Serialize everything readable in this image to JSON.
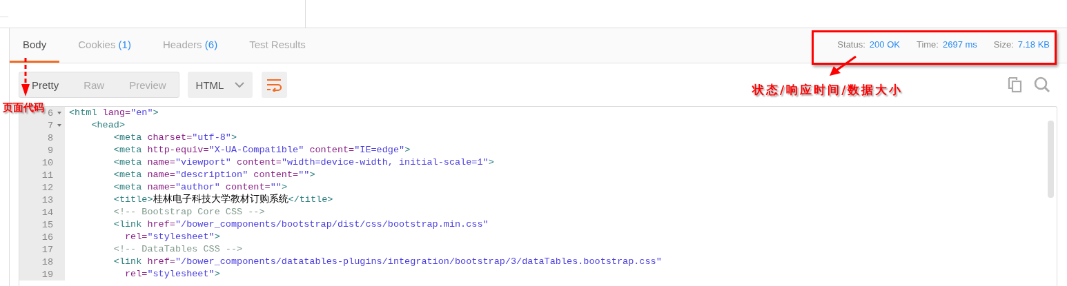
{
  "tabs": [
    {
      "label": "Body",
      "selected": true
    },
    {
      "label": "Cookies",
      "count": "(1)",
      "selected": false
    },
    {
      "label": "Headers",
      "count": "(6)",
      "selected": false
    },
    {
      "label": "Test Results",
      "selected": false
    }
  ],
  "status": [
    {
      "label": "Status:",
      "value": "200 OK"
    },
    {
      "label": "Time:",
      "value": "2697 ms"
    },
    {
      "label": "Size:",
      "value": "7.18 KB"
    }
  ],
  "view_modes": [
    {
      "label": "Pretty",
      "selected": true
    },
    {
      "label": "Raw",
      "selected": false
    },
    {
      "label": "Preview",
      "selected": false
    }
  ],
  "format": {
    "value": "HTML"
  },
  "code_lines": [
    {
      "number": "6",
      "fold": true,
      "tokens": [
        {
          "kind": "tag",
          "text": "<html "
        },
        {
          "kind": "attr",
          "text": "lang="
        },
        {
          "kind": "value",
          "text": "\"en\""
        },
        {
          "kind": "tag",
          "text": ">"
        }
      ]
    },
    {
      "number": "7",
      "fold": true,
      "tokens": [
        {
          "kind": "tag",
          "text": "    <head>"
        }
      ]
    },
    {
      "number": "8",
      "fold": false,
      "tokens": [
        {
          "kind": "tag",
          "text": "        <meta "
        },
        {
          "kind": "attr",
          "text": "charset="
        },
        {
          "kind": "value",
          "text": "\"utf-8\""
        },
        {
          "kind": "tag",
          "text": ">"
        }
      ]
    },
    {
      "number": "9",
      "fold": false,
      "tokens": [
        {
          "kind": "tag",
          "text": "        <meta "
        },
        {
          "kind": "attr",
          "text": "http-equiv="
        },
        {
          "kind": "value",
          "text": "\"X-UA-Compatible\""
        },
        {
          "kind": "attr",
          "text": " content="
        },
        {
          "kind": "value",
          "text": "\"IE=edge\""
        },
        {
          "kind": "tag",
          "text": ">"
        }
      ]
    },
    {
      "number": "10",
      "fold": false,
      "tokens": [
        {
          "kind": "tag",
          "text": "        <meta "
        },
        {
          "kind": "attr",
          "text": "name="
        },
        {
          "kind": "value",
          "text": "\"viewport\""
        },
        {
          "kind": "attr",
          "text": " content="
        },
        {
          "kind": "value",
          "text": "\"width=device-width, initial-scale=1\""
        },
        {
          "kind": "tag",
          "text": ">"
        }
      ]
    },
    {
      "number": "11",
      "fold": false,
      "tokens": [
        {
          "kind": "tag",
          "text": "        <meta "
        },
        {
          "kind": "attr",
          "text": "name="
        },
        {
          "kind": "value",
          "text": "\"description\""
        },
        {
          "kind": "attr",
          "text": " content="
        },
        {
          "kind": "value",
          "text": "\"\""
        },
        {
          "kind": "tag",
          "text": ">"
        }
      ]
    },
    {
      "number": "12",
      "fold": false,
      "tokens": [
        {
          "kind": "tag",
          "text": "        <meta "
        },
        {
          "kind": "attr",
          "text": "name="
        },
        {
          "kind": "value",
          "text": "\"author\""
        },
        {
          "kind": "attr",
          "text": " content="
        },
        {
          "kind": "value",
          "text": "\"\""
        },
        {
          "kind": "tag",
          "text": ">"
        }
      ]
    },
    {
      "number": "13",
      "fold": false,
      "tokens": [
        {
          "kind": "tag",
          "text": "        <title>"
        },
        {
          "kind": "text",
          "text": "桂林电子科技大学教材订购系统"
        },
        {
          "kind": "tag",
          "text": "</title>"
        }
      ]
    },
    {
      "number": "14",
      "fold": false,
      "tokens": [
        {
          "kind": "comment",
          "text": "        <!-- Bootstrap Core CSS -->"
        }
      ]
    },
    {
      "number": "15",
      "fold": false,
      "tokens": [
        {
          "kind": "tag",
          "text": "        <link "
        },
        {
          "kind": "attr",
          "text": "href="
        },
        {
          "kind": "value",
          "text": "\"/bower_components/bootstrap/dist/css/bootstrap.min.css\""
        }
      ]
    },
    {
      "number": "16",
      "fold": false,
      "tokens": [
        {
          "kind": "attr",
          "text": "          rel="
        },
        {
          "kind": "value",
          "text": "\"stylesheet\""
        },
        {
          "kind": "tag",
          "text": ">"
        }
      ]
    },
    {
      "number": "17",
      "fold": false,
      "tokens": [
        {
          "kind": "comment",
          "text": "        <!-- DataTables CSS -->"
        }
      ]
    },
    {
      "number": "18",
      "fold": false,
      "tokens": [
        {
          "kind": "tag",
          "text": "        <link "
        },
        {
          "kind": "attr",
          "text": "href="
        },
        {
          "kind": "value",
          "text": "\"/bower_components/datatables-plugins/integration/bootstrap/3/dataTables.bootstrap.css\""
        }
      ]
    },
    {
      "number": "19",
      "fold": false,
      "tokens": [
        {
          "kind": "attr",
          "text": "          rel="
        },
        {
          "kind": "value",
          "text": "\"stylesheet\""
        },
        {
          "kind": "tag",
          "text": ">"
        }
      ]
    }
  ],
  "annotations": [
    {
      "kind": "status",
      "text": "状态/响应时间/数据大小"
    },
    {
      "kind": "body",
      "text": "页面代码"
    }
  ]
}
